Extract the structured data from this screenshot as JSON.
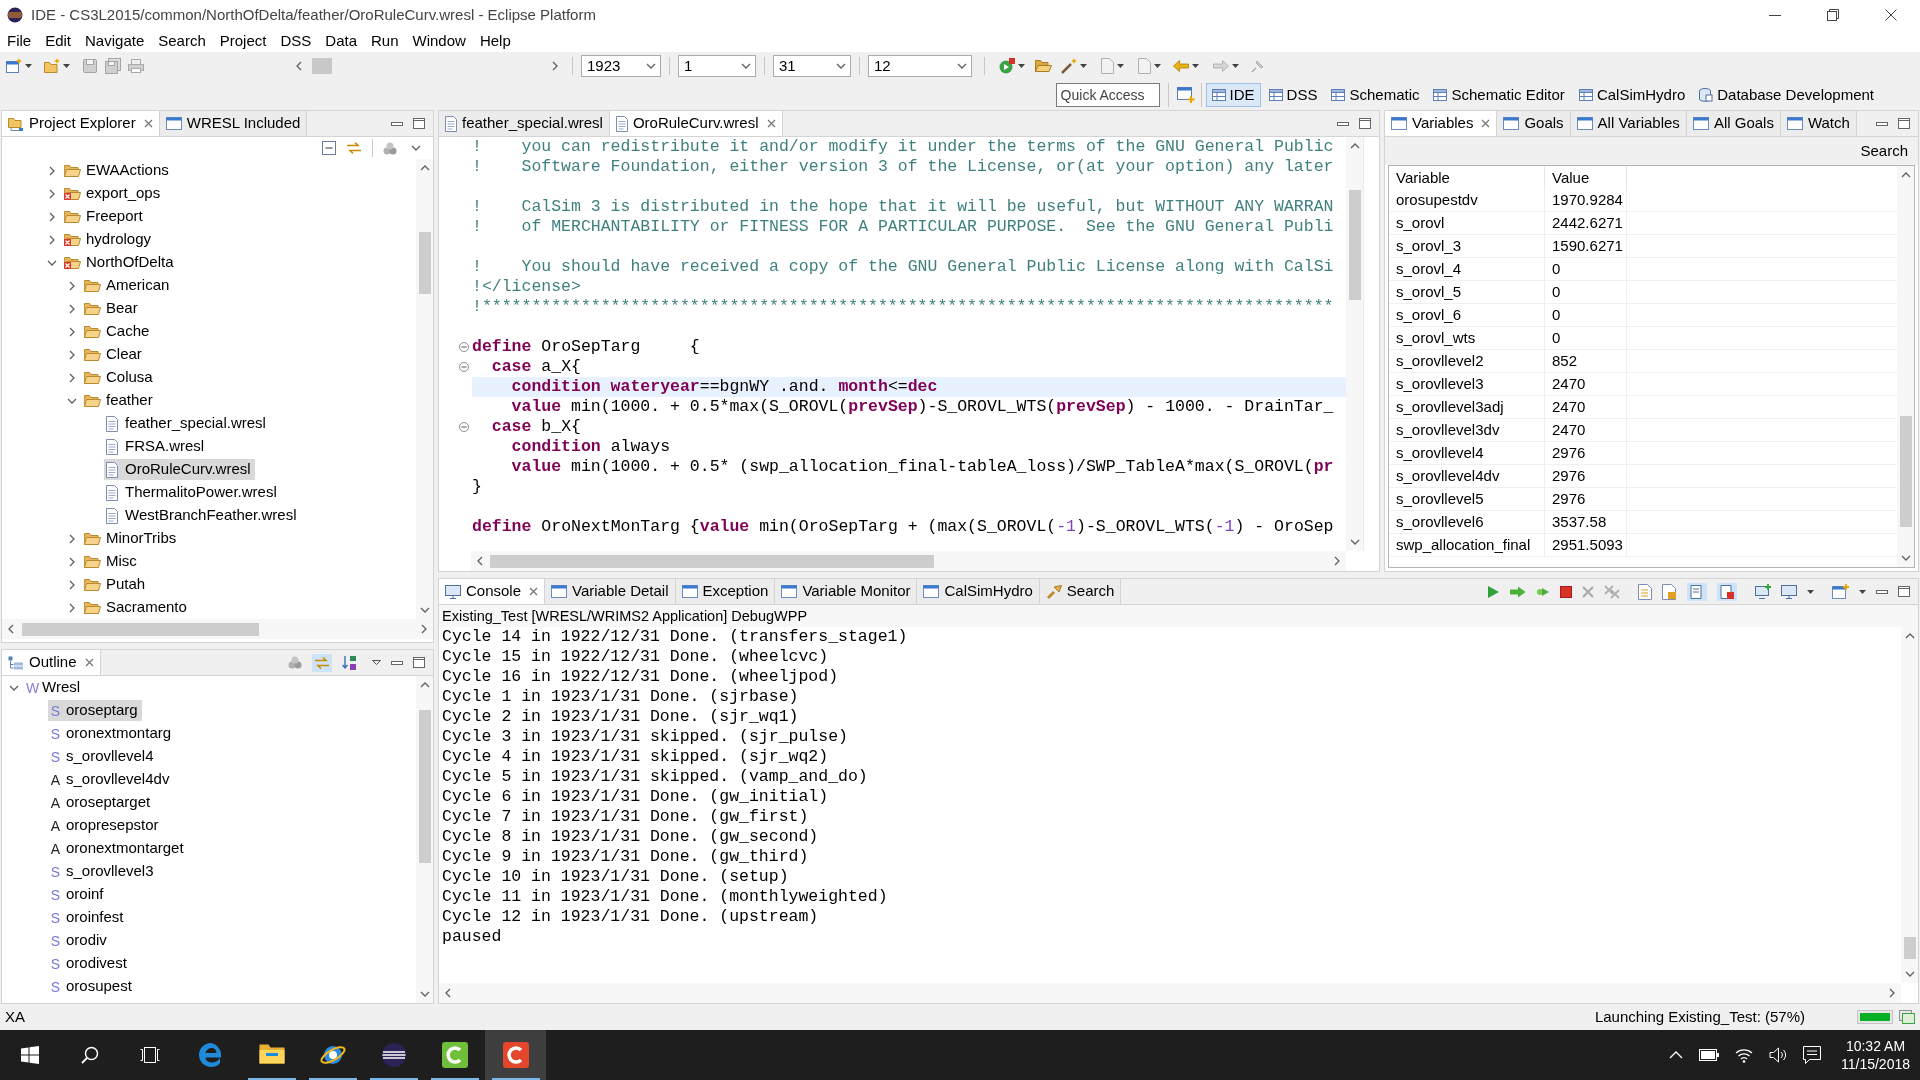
{
  "window": {
    "title": "IDE - CS3L2015/common/NorthOfDelta/feather/OroRuleCurv.wresl - Eclipse Platform"
  },
  "menu_bar": [
    "File",
    "Edit",
    "Navigate",
    "Search",
    "Project",
    "DSS",
    "Data",
    "Run",
    "Window",
    "Help"
  ],
  "toolbar": {
    "combos": [
      {
        "value": "1923"
      },
      {
        "value": "1"
      },
      {
        "value": "31"
      },
      {
        "value": "12"
      }
    ],
    "quick_access": {
      "placeholder": "Quick Access"
    },
    "perspectives": [
      {
        "label": "IDE",
        "kind": "grid",
        "selected": true
      },
      {
        "label": "DSS",
        "kind": "grid",
        "selected": false
      },
      {
        "label": "Schematic",
        "kind": "grid",
        "selected": false
      },
      {
        "label": "Schematic Editor",
        "kind": "grid",
        "selected": false
      },
      {
        "label": "CalSimHydro",
        "kind": "grid",
        "selected": false
      },
      {
        "label": "Database Development",
        "kind": "database",
        "selected": false
      }
    ]
  },
  "project_explorer": {
    "tabs": [
      {
        "label": "Project Explorer",
        "kind": "explorer",
        "selected": true
      },
      {
        "label": "WRESL Included",
        "kind": "view",
        "selected": false
      }
    ],
    "tree": [
      {
        "label": "EWAActions",
        "kind": "folder",
        "error": false,
        "expanded": false,
        "selected": false
      },
      {
        "label": "export_ops",
        "kind": "folder",
        "error": true,
        "expanded": false,
        "selected": false
      },
      {
        "label": "Freeport",
        "kind": "folder",
        "error": false,
        "expanded": false,
        "selected": false
      },
      {
        "label": "hydrology",
        "kind": "folder",
        "error": true,
        "expanded": false,
        "selected": false
      },
      {
        "label": "NorthOfDelta",
        "kind": "folder",
        "error": true,
        "expanded": true,
        "selected": false,
        "children": [
          {
            "label": "American",
            "kind": "folder",
            "error": false,
            "expanded": false,
            "selected": false
          },
          {
            "label": "Bear",
            "kind": "folder",
            "error": false,
            "expanded": false,
            "selected": false
          },
          {
            "label": "Cache",
            "kind": "folder",
            "error": false,
            "expanded": false,
            "selected": false
          },
          {
            "label": "Clear",
            "kind": "folder",
            "error": false,
            "expanded": false,
            "selected": false
          },
          {
            "label": "Colusa",
            "kind": "folder",
            "error": false,
            "expanded": false,
            "selected": false
          },
          {
            "label": "feather",
            "kind": "folder",
            "error": false,
            "expanded": true,
            "selected": false,
            "children": [
              {
                "label": "feather_special.wresl",
                "kind": "file",
                "error": false,
                "selected": false
              },
              {
                "label": "FRSA.wresl",
                "kind": "file",
                "error": false,
                "selected": false
              },
              {
                "label": "OroRuleCurv.wresl",
                "kind": "file",
                "error": false,
                "selected": true
              },
              {
                "label": "ThermalitoPower.wresl",
                "kind": "file",
                "error": false,
                "selected": false
              },
              {
                "label": "WestBranchFeather.wresl",
                "kind": "file",
                "error": false,
                "selected": false
              }
            ]
          },
          {
            "label": "MinorTribs",
            "kind": "folder",
            "error": false,
            "expanded": false,
            "selected": false
          },
          {
            "label": "Misc",
            "kind": "folder",
            "error": false,
            "expanded": false,
            "selected": false
          },
          {
            "label": "Putah",
            "kind": "folder",
            "error": false,
            "expanded": false,
            "selected": false
          },
          {
            "label": "Sacramento",
            "kind": "folder",
            "error": false,
            "expanded": false,
            "selected": false
          }
        ]
      }
    ]
  },
  "outline": {
    "tabs": [
      {
        "label": "Outline",
        "selected": true
      }
    ],
    "tree": [
      {
        "icon": "W",
        "label": "Wresl",
        "color": "#8c78d8",
        "expanded": true,
        "selected": false,
        "children": [
          {
            "icon": "S",
            "label": "oroseptarg",
            "color": "#7878da",
            "selected": true
          },
          {
            "icon": "S",
            "label": "oronextmontarg",
            "color": "#7878da",
            "selected": false
          },
          {
            "icon": "S",
            "label": "s_orovllevel4",
            "color": "#7878da",
            "selected": false
          },
          {
            "icon": "A",
            "label": "s_orovllevel4dv",
            "color": "#222222",
            "selected": false
          },
          {
            "icon": "A",
            "label": "oroseptarget",
            "color": "#222222",
            "selected": false
          },
          {
            "icon": "A",
            "label": "oropresepstor",
            "color": "#222222",
            "selected": false
          },
          {
            "icon": "A",
            "label": "oronextmontarget",
            "color": "#222222",
            "selected": false
          },
          {
            "icon": "S",
            "label": "s_orovllevel3",
            "color": "#7878da",
            "selected": false
          },
          {
            "icon": "S",
            "label": "oroinf",
            "color": "#7878da",
            "selected": false
          },
          {
            "icon": "S",
            "label": "oroinfest",
            "color": "#7878da",
            "selected": false
          },
          {
            "icon": "S",
            "label": "orodiv",
            "color": "#7878da",
            "selected": false
          },
          {
            "icon": "S",
            "label": "orodivest",
            "color": "#7878da",
            "selected": false
          },
          {
            "icon": "S",
            "label": "orosupest",
            "color": "#7878da",
            "selected": false
          }
        ]
      }
    ]
  },
  "editor": {
    "tabs": [
      {
        "label": "feather_special.wresl",
        "selected": false
      },
      {
        "label": "OroRuleCurv.wresl",
        "selected": true
      }
    ],
    "lines": [
      {
        "tokens": [
          {
            "kind": "comment",
            "text": "!    you can redistribute it and/or modify it under the terms of the GNU General Public"
          }
        ],
        "current": false,
        "fold_marker": false
      },
      {
        "tokens": [
          {
            "kind": "comment",
            "text": "!    Software Foundation, either version 3 of the License, or(at your option) any later"
          }
        ],
        "current": false,
        "fold_marker": false
      },
      {
        "current": false,
        "fold_marker": false
      },
      {
        "tokens": [
          {
            "kind": "comment",
            "text": "!    CalSim 3 is distributed in the hope that it will be useful, but WITHOUT ANY WARRAN"
          }
        ],
        "current": false,
        "fold_marker": false
      },
      {
        "tokens": [
          {
            "kind": "comment",
            "text": "!    of MERCHANTABILITY or FITNESS FOR A PARTICULAR PURPOSE.  See the GNU General Publi"
          }
        ],
        "current": false,
        "fold_marker": false
      },
      {
        "current": false,
        "fold_marker": false
      },
      {
        "tokens": [
          {
            "kind": "comment",
            "text": "!    You should have received a copy of the GNU General Public License along with CalSi"
          }
        ],
        "current": false,
        "fold_marker": false
      },
      {
        "tokens": [
          {
            "kind": "comment",
            "text": "!</license>"
          }
        ],
        "current": false,
        "fold_marker": false
      },
      {
        "tokens": [
          {
            "kind": "comment",
            "text": "!**************************************************************************************"
          }
        ],
        "current": false,
        "fold_marker": false
      },
      {
        "current": false,
        "fold_marker": false
      },
      {
        "tokens": [
          {
            "kind": "keyword",
            "text": "define"
          },
          {
            "kind": "plain",
            "text": " OroSepTarg     {"
          }
        ],
        "current": false,
        "fold_marker": true
      },
      {
        "tokens": [
          {
            "kind": "keyword",
            "text": "  case"
          },
          {
            "kind": "plain",
            "text": " a_X{"
          }
        ],
        "current": false,
        "fold_marker": true
      },
      {
        "tokens": [
          {
            "kind": "keyword",
            "text": "    condition wateryear"
          },
          {
            "kind": "plain",
            "text": "==bgnWY .and. "
          },
          {
            "kind": "keyword",
            "text": "month"
          },
          {
            "kind": "plain",
            "text": "<="
          },
          {
            "kind": "keyword",
            "text": "dec"
          }
        ],
        "current": true,
        "fold_marker": false
      },
      {
        "tokens": [
          {
            "kind": "keyword",
            "text": "    value"
          },
          {
            "kind": "plain",
            "text": " min(1000. + 0.5*max(S_OROVL("
          },
          {
            "kind": "keyword",
            "text": "prevSep"
          },
          {
            "kind": "plain",
            "text": ")-S_OROVL_WTS("
          },
          {
            "kind": "keyword",
            "text": "prevSep"
          },
          {
            "kind": "plain",
            "text": ") - 1000. - DrainTar_"
          }
        ],
        "current": false,
        "fold_marker": false
      },
      {
        "tokens": [
          {
            "kind": "keyword",
            "text": "  case"
          },
          {
            "kind": "plain",
            "text": " b_X{"
          }
        ],
        "current": false,
        "fold_marker": true
      },
      {
        "tokens": [
          {
            "kind": "keyword",
            "text": "    condition"
          },
          {
            "kind": "plain",
            "text": " always"
          }
        ],
        "current": false,
        "fold_marker": false
      },
      {
        "tokens": [
          {
            "kind": "keyword",
            "text": "    value"
          },
          {
            "kind": "plain",
            "text": " min(1000. + 0.5* (swp_allocation_final-tableA_loss)/SWP_TableA*max(S_OROVL("
          },
          {
            "kind": "keyword",
            "text": "pr"
          }
        ],
        "current": false,
        "fold_marker": false
      },
      {
        "tokens": [
          {
            "kind": "plain",
            "text": "}"
          }
        ],
        "current": false,
        "fold_marker": false
      },
      {
        "current": false,
        "fold_marker": false
      },
      {
        "tokens": [
          {
            "kind": "keyword",
            "text": "define"
          },
          {
            "kind": "plain",
            "text": " OroNextMonTarg {"
          },
          {
            "kind": "keyword",
            "text": "value"
          },
          {
            "kind": "plain",
            "text": " min(OroSepTarg + (max(S_OROVL("
          },
          {
            "kind": "number",
            "text": "-1"
          },
          {
            "kind": "plain",
            "text": ")-S_OROVL_WTS("
          },
          {
            "kind": "number",
            "text": "-1"
          },
          {
            "kind": "plain",
            "text": ") - OroSep"
          }
        ],
        "current": false,
        "fold_marker": false
      }
    ]
  },
  "variables_view": {
    "tabs": [
      {
        "label": "Variables",
        "selected": true
      },
      {
        "label": "Goals",
        "selected": false
      },
      {
        "label": "All Variables",
        "selected": false
      },
      {
        "label": "All Goals",
        "selected": false
      },
      {
        "label": "Watch",
        "selected": false
      }
    ],
    "search": "Search",
    "table": {
      "columns": [
        "Variable",
        "Value"
      ],
      "rows": [
        [
          "orosupestdv",
          "1970.9284"
        ],
        [
          "s_orovl",
          "2442.6271"
        ],
        [
          "s_orovl_3",
          "1590.6271"
        ],
        [
          "s_orovl_4",
          "0"
        ],
        [
          "s_orovl_5",
          "0"
        ],
        [
          "s_orovl_6",
          "0"
        ],
        [
          "s_orovl_wts",
          "0"
        ],
        [
          "s_orovllevel2",
          "852"
        ],
        [
          "s_orovllevel3",
          "2470"
        ],
        [
          "s_orovllevel3adj",
          "2470"
        ],
        [
          "s_orovllevel3dv",
          "2470"
        ],
        [
          "s_orovllevel4",
          "2976"
        ],
        [
          "s_orovllevel4dv",
          "2976"
        ],
        [
          "s_orovllevel5",
          "2976"
        ],
        [
          "s_orovllevel6",
          "3537.58"
        ],
        [
          "swp_allocation_final",
          "2951.5093"
        ]
      ]
    }
  },
  "console": {
    "tabs": [
      {
        "label": "Console",
        "kind": "console",
        "selected": true
      },
      {
        "label": "Variable Detail",
        "kind": "view",
        "selected": false
      },
      {
        "label": "Exception",
        "kind": "view",
        "selected": false
      },
      {
        "label": "Variable Monitor",
        "kind": "view",
        "selected": false
      },
      {
        "label": "CalSimHydro",
        "kind": "view",
        "selected": false
      },
      {
        "label": "Search",
        "kind": "search",
        "selected": false
      }
    ],
    "process": "Existing_Test [WRESL/WRIMS2 Application] DebugWPP",
    "lines": [
      "Cycle 14 in 1922/12/31 Done. (transfers_stage1)",
      "Cycle 15 in 1922/12/31 Done. (wheelcvc)",
      "Cycle 16 in 1922/12/31 Done. (wheeljpod)",
      "Cycle 1 in 1923/1/31 Done. (sjrbase)",
      "Cycle 2 in 1923/1/31 Done. (sjr_wq1)",
      "Cycle 3 in 1923/1/31 skipped. (sjr_pulse)",
      "Cycle 4 in 1923/1/31 skipped. (sjr_wq2)",
      "Cycle 5 in 1923/1/31 skipped. (vamp_and_do)",
      "Cycle 6 in 1923/1/31 Done. (gw_initial)",
      "Cycle 7 in 1923/1/31 Done. (gw_first)",
      "Cycle 8 in 1923/1/31 Done. (gw_second)",
      "Cycle 9 in 1923/1/31 Done. (gw_third)",
      "Cycle 10 in 1923/1/31 Done. (setup)",
      "Cycle 11 in 1923/1/31 Done. (monthlyweighted)",
      "Cycle 12 in 1923/1/31 Done. (upstream)",
      "paused"
    ]
  },
  "status_bar": {
    "left": "XA",
    "task": "Launching Existing_Test: (57%)",
    "progress": {
      "level": 1
    }
  },
  "taskbar": {
    "apps": [
      {
        "kind": "swirl",
        "running": false,
        "selected": false
      },
      {
        "kind": "folder",
        "running": true,
        "selected": false
      },
      {
        "kind": "orbit",
        "running": true,
        "selected": false
      },
      {
        "kind": "striped-circle",
        "running": true,
        "selected": false
      },
      {
        "kind": "green-tile",
        "running": true,
        "selected": false
      },
      {
        "kind": "red-tile",
        "running": true,
        "selected": true
      }
    ],
    "time": "10:32 AM",
    "date": "11/15/2018"
  }
}
